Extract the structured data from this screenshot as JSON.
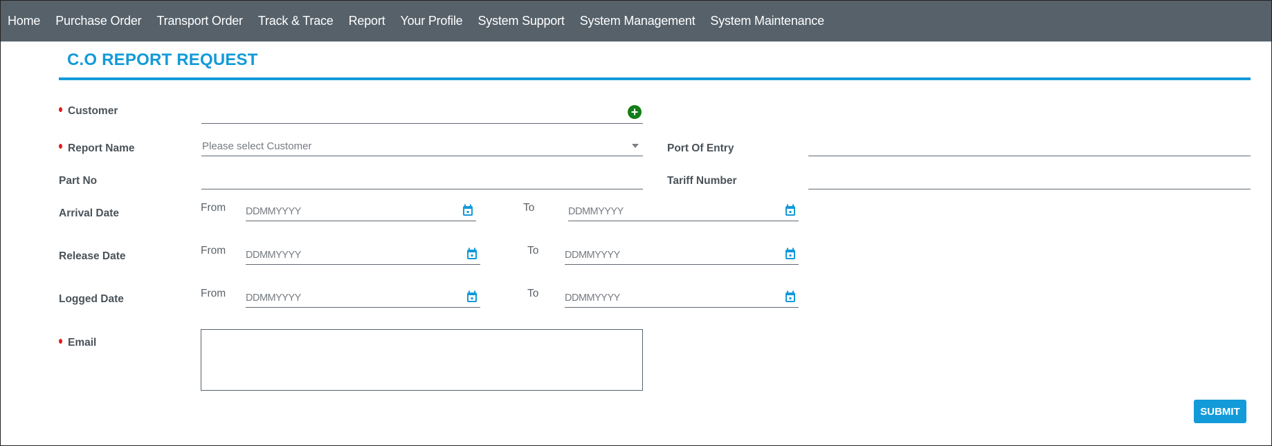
{
  "nav": {
    "items": [
      {
        "label": "Home"
      },
      {
        "label": "Purchase Order"
      },
      {
        "label": "Transport Order"
      },
      {
        "label": "Track & Trace"
      },
      {
        "label": "Report"
      },
      {
        "label": "Your Profile"
      },
      {
        "label": "System Support"
      },
      {
        "label": "System Management"
      },
      {
        "label": "System Maintenance"
      }
    ]
  },
  "page": {
    "title": "C.O REPORT REQUEST"
  },
  "form": {
    "customer": {
      "label": "Customer",
      "value": "",
      "required": true,
      "add_icon": "plus-circle-icon"
    },
    "report_name": {
      "label": "Report Name",
      "placeholder": "Please select Customer",
      "required": true
    },
    "port_of_entry": {
      "label": "Port Of Entry",
      "value": ""
    },
    "part_no": {
      "label": "Part No",
      "value": ""
    },
    "tariff_number": {
      "label": "Tariff Number",
      "value": ""
    },
    "from_label": "From",
    "to_label": "To",
    "date_placeholder": "DDMMYYYY",
    "arrival_date": {
      "label": "Arrival Date",
      "from": "",
      "to": ""
    },
    "release_date": {
      "label": "Release Date",
      "from": "",
      "to": ""
    },
    "logged_date": {
      "label": "Logged Date",
      "from": "",
      "to": ""
    },
    "email": {
      "label": "Email",
      "value": "",
      "required": true
    },
    "submit_label": "SUBMIT"
  },
  "colors": {
    "nav_bg": "#56616a",
    "accent": "#139ad9",
    "required": "#e8191a",
    "add_icon": "#127e17"
  }
}
